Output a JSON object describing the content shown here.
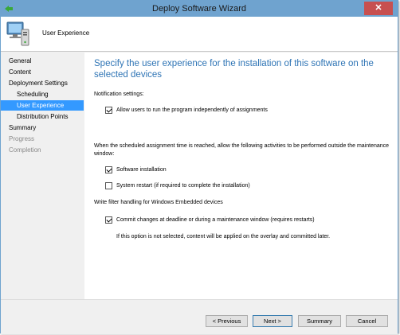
{
  "window": {
    "title": "Deploy Software Wizard",
    "close_glyph": "✕"
  },
  "header": {
    "title": "User Experience",
    "icon": "computer-icon"
  },
  "nav": {
    "items": [
      {
        "label": "General",
        "state": "normal"
      },
      {
        "label": "Content",
        "state": "normal"
      },
      {
        "label": "Deployment Settings",
        "state": "normal"
      },
      {
        "label": "Scheduling",
        "state": "normal"
      },
      {
        "label": "User Experience",
        "state": "selected"
      },
      {
        "label": "Distribution Points",
        "state": "normal"
      },
      {
        "label": "Summary",
        "state": "normal"
      },
      {
        "label": "Progress",
        "state": "disabled"
      },
      {
        "label": "Completion",
        "state": "disabled"
      }
    ]
  },
  "main": {
    "heading": "Specify the user experience for the installation of this software on the selected devices",
    "notification_label": "Notification settings:",
    "allow_users_label": "Allow users to run the program independently of assignments",
    "allow_users_checked": true,
    "maintenance_label": "When the scheduled assignment time is reached, allow the following activities to be performed outside the maintenance window:",
    "software_install_label": "Software installation",
    "software_install_checked": true,
    "system_restart_label": "System restart  (if required to complete the installation)",
    "system_restart_checked": false,
    "write_filter_label": "Write filter handling for Windows Embedded devices",
    "commit_changes_label": "Commit changes at deadline or during a maintenance window (requires restarts)",
    "commit_changes_checked": true,
    "commit_note": "If this option is not selected, content will be applied on the overlay and committed later."
  },
  "footer": {
    "previous_label": "< Previous",
    "next_label": "Next >",
    "summary_label": "Summary",
    "cancel_label": "Cancel"
  },
  "colors": {
    "titlebar": "#6fa3cf",
    "heading": "#2e74b5",
    "selected_nav": "#3399ff",
    "close_button": "#c75050"
  }
}
